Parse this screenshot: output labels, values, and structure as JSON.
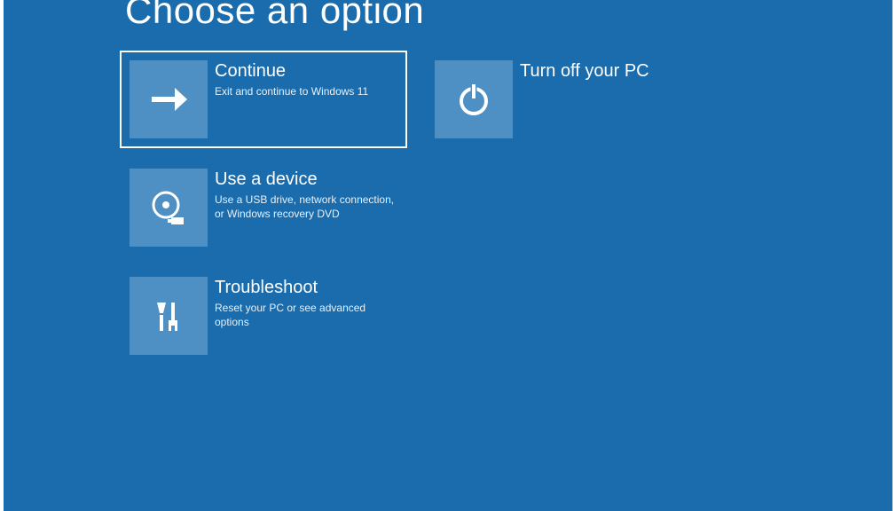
{
  "title": "Choose an option",
  "options": {
    "continue": {
      "title": "Continue",
      "desc": "Exit and continue to Windows 11"
    },
    "turnoff": {
      "title": "Turn off your PC",
      "desc": ""
    },
    "device": {
      "title": "Use a device",
      "desc": "Use a USB drive, network connection, or Windows recovery DVD"
    },
    "troubleshoot": {
      "title": "Troubleshoot",
      "desc": "Reset your PC or see advanced options"
    }
  }
}
